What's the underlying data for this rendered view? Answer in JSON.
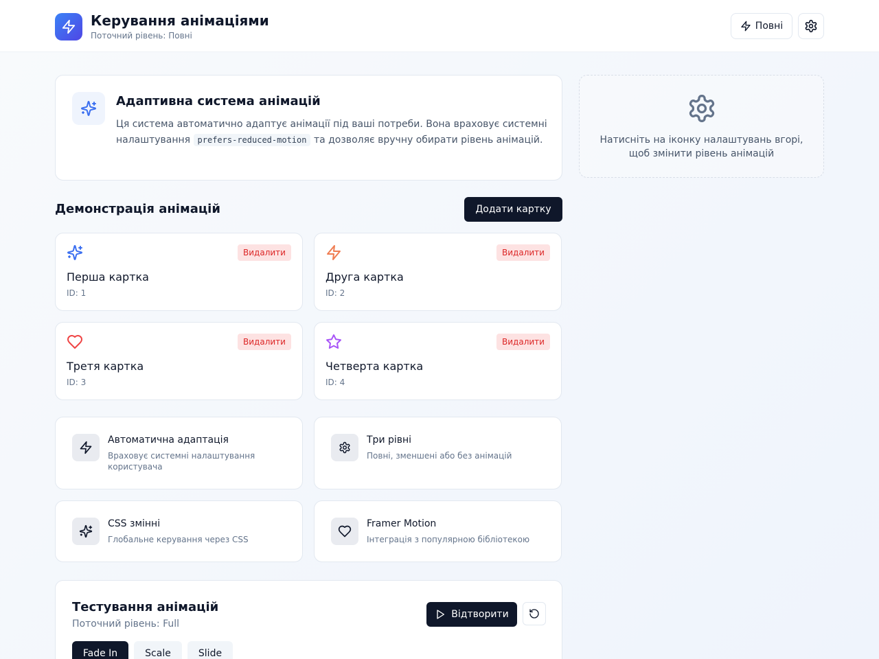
{
  "header": {
    "title": "Керування анімаціями",
    "subtitle": "Поточний рівень: Повні",
    "level_button": "Повні",
    "logo_icon": "zap-icon",
    "settings_icon": "gear-icon",
    "brand_colors": [
      "#3b82f6",
      "#4f46e5"
    ]
  },
  "info": {
    "title": "Адаптивна система анімацій",
    "desc_before": "Ця система автоматично адаптує анімації під ваші потреби. Вона враховує системні налаштування",
    "code": "prefers-reduced-motion",
    "desc_after": "та дозволяє вручну обирати рівень анімацій.",
    "icon": "sparkles-icon"
  },
  "hint": {
    "text": "Натисніть на іконку налаштувань вгорі, щоб змінити рівень анімацій",
    "icon": "gear-icon"
  },
  "demo": {
    "title": "Демонстрація анімацій",
    "add_button": "Додати картку",
    "delete_label": "Видалити",
    "cards": [
      {
        "name": "Перша картка",
        "id": "ID: 1",
        "icon": "sparkles-icon",
        "color": "#3b6ff0"
      },
      {
        "name": "Друга картка",
        "id": "ID: 2",
        "icon": "zap-icon",
        "color": "#f07d52"
      },
      {
        "name": "Третя картка",
        "id": "ID: 3",
        "icon": "heart-icon",
        "color": "#ef4444"
      },
      {
        "name": "Четверта картка",
        "id": "ID: 4",
        "icon": "star-icon",
        "color": "#a855f7"
      }
    ]
  },
  "features": [
    {
      "title": "Автоматична адаптація",
      "desc": "Враховує системні налаштування користувача",
      "icon": "zap-icon"
    },
    {
      "title": "Три рівні",
      "desc": "Повні, зменшені або без анімацій",
      "icon": "gear-icon"
    },
    {
      "title": "CSS змінні",
      "desc": "Глобальне керування через CSS",
      "icon": "sparkles-icon"
    },
    {
      "title": "Framer Motion",
      "desc": "Інтеграція з популярною бібліотекою",
      "icon": "heart-icon"
    }
  ],
  "test": {
    "title": "Тестування анімацій",
    "subtitle": "Поточний рівень: Full",
    "play_button": "Відтворити",
    "tabs": [
      "Fade In",
      "Scale",
      "Slide"
    ],
    "active_tab": "Fade In"
  }
}
